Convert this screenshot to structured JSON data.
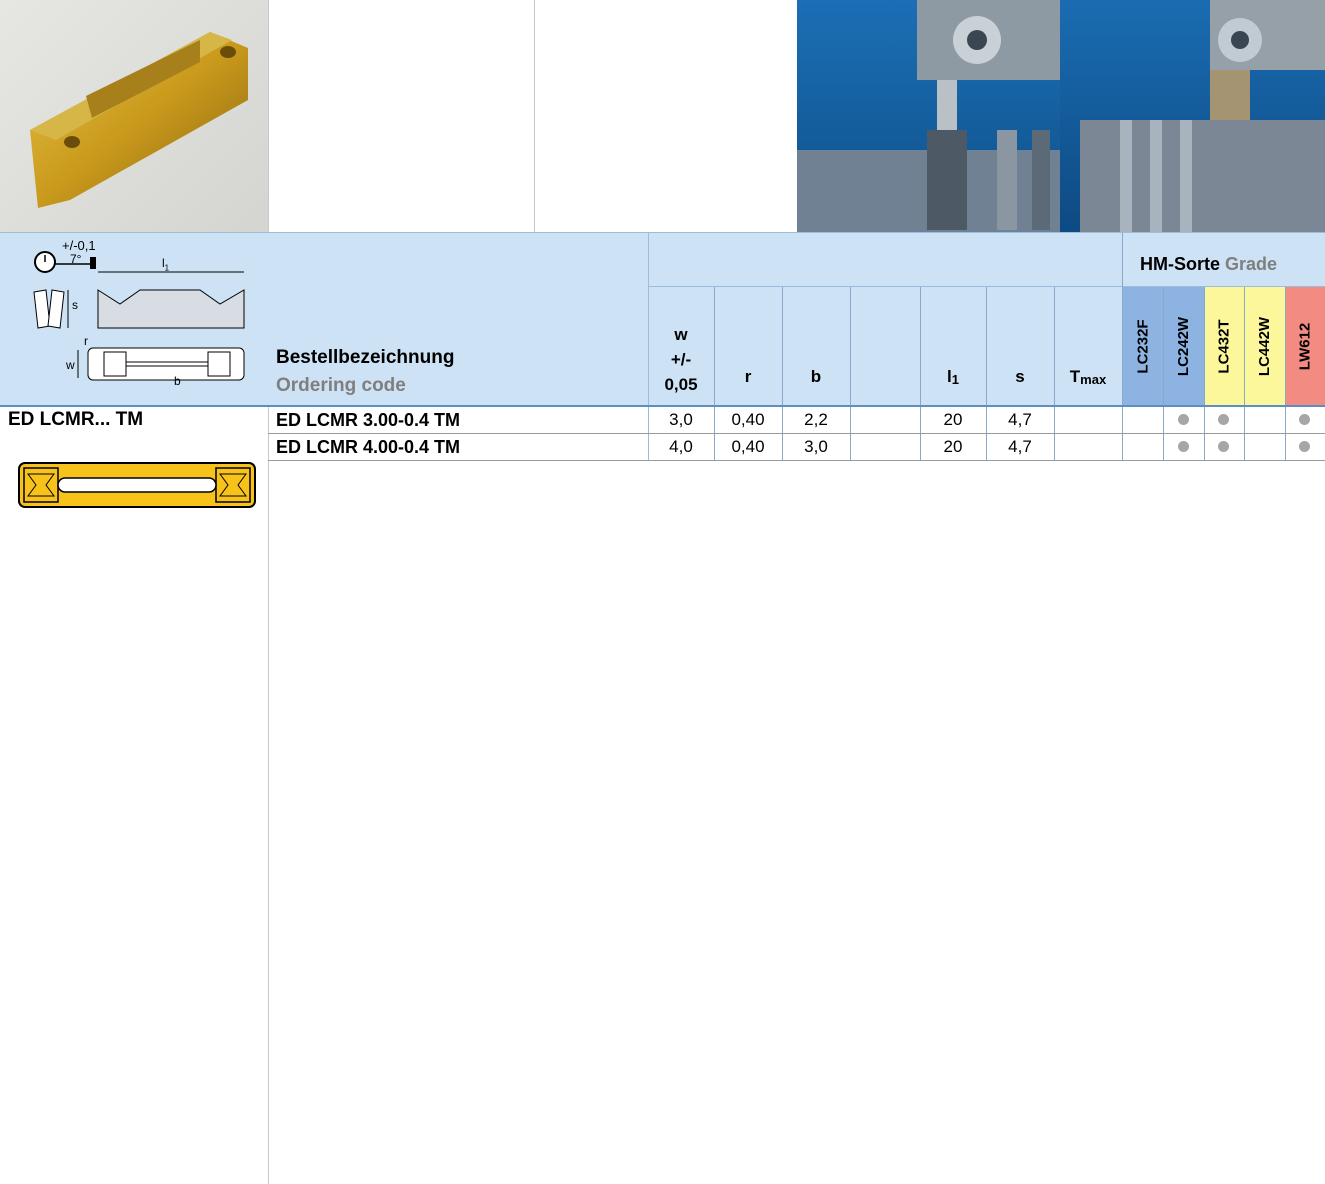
{
  "family": {
    "name": "ED LCMR... TM"
  },
  "header": {
    "order_de": "Bestellbezeichnung",
    "order_en": "Ordering code",
    "grade_de": "HM-Sorte",
    "grade_en": "Grade",
    "w": "w",
    "w_tol": "+/-",
    "w_tol_val": "0,05",
    "r": "r",
    "b": "b",
    "l1": "l",
    "l1_sub": "1",
    "s": "s",
    "tmax": "T",
    "tmax_sub": "max"
  },
  "diagram": {
    "tol": "+/-0,1",
    "angle": "7°",
    "l1": "l",
    "l1_sub": "1",
    "s": "s",
    "r": "r",
    "w": "w",
    "b": "b"
  },
  "grades": [
    {
      "name": "LC232F",
      "color": "#8db3e2"
    },
    {
      "name": "LC242W",
      "color": "#8db3e2"
    },
    {
      "name": "LC432T",
      "color": "#fdf79b"
    },
    {
      "name": "LC442W",
      "color": "#fdf79b"
    },
    {
      "name": "LW612",
      "color": "#f28b82"
    }
  ],
  "rows": [
    {
      "code": "ED LCMR 3.00-0.4 TM",
      "w": "3,0",
      "r": "0,40",
      "b": "2,2",
      "blank": "",
      "l1": "20",
      "s": "4,7",
      "tmax": "",
      "grades": [
        false,
        true,
        true,
        false,
        true
      ]
    },
    {
      "code": "ED LCMR 4.00-0.4 TM",
      "w": "4,0",
      "r": "0,40",
      "b": "3,0",
      "blank": "",
      "l1": "20",
      "s": "4,7",
      "tmax": "",
      "grades": [
        false,
        true,
        true,
        false,
        true
      ]
    }
  ]
}
